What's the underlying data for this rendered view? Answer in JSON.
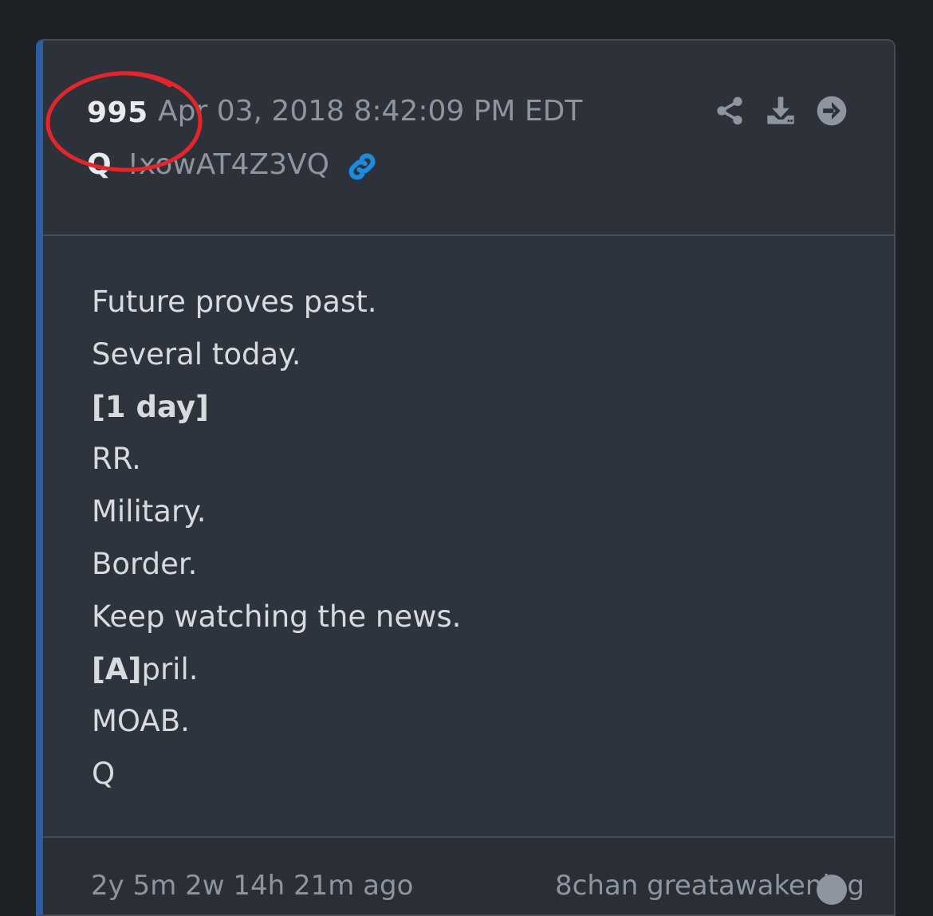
{
  "post": {
    "number": "995",
    "date": "Apr 03, 2018 8:42:09 PM EDT",
    "author_name": "Q",
    "tripcode": "!xowAT4Z3VQ",
    "icons": {
      "link": "link-icon",
      "share": "share-icon",
      "download": "download-icon",
      "go": "arrow-right-circle-icon"
    },
    "lines": [
      {
        "bold": "",
        "text": "Future proves past."
      },
      {
        "bold": "",
        "text": "Several today."
      },
      {
        "bold": "[1 day]",
        "text": ""
      },
      {
        "bold": "",
        "text": "RR."
      },
      {
        "bold": "",
        "text": "Military."
      },
      {
        "bold": "",
        "text": "Border."
      },
      {
        "bold": "",
        "text": "Keep watching the news."
      },
      {
        "bold": "[A]",
        "text": "pril."
      },
      {
        "bold": "",
        "text": "MOAB."
      },
      {
        "bold": "",
        "text": "Q"
      }
    ],
    "footer": {
      "relative_time": "2y 5m 2w 14h 21m ago",
      "source": "8chan greatawakening"
    }
  },
  "colors": {
    "accent": "#2a5fa8",
    "link_icon": "#1a8ce0",
    "annotation": "#e2262b"
  }
}
